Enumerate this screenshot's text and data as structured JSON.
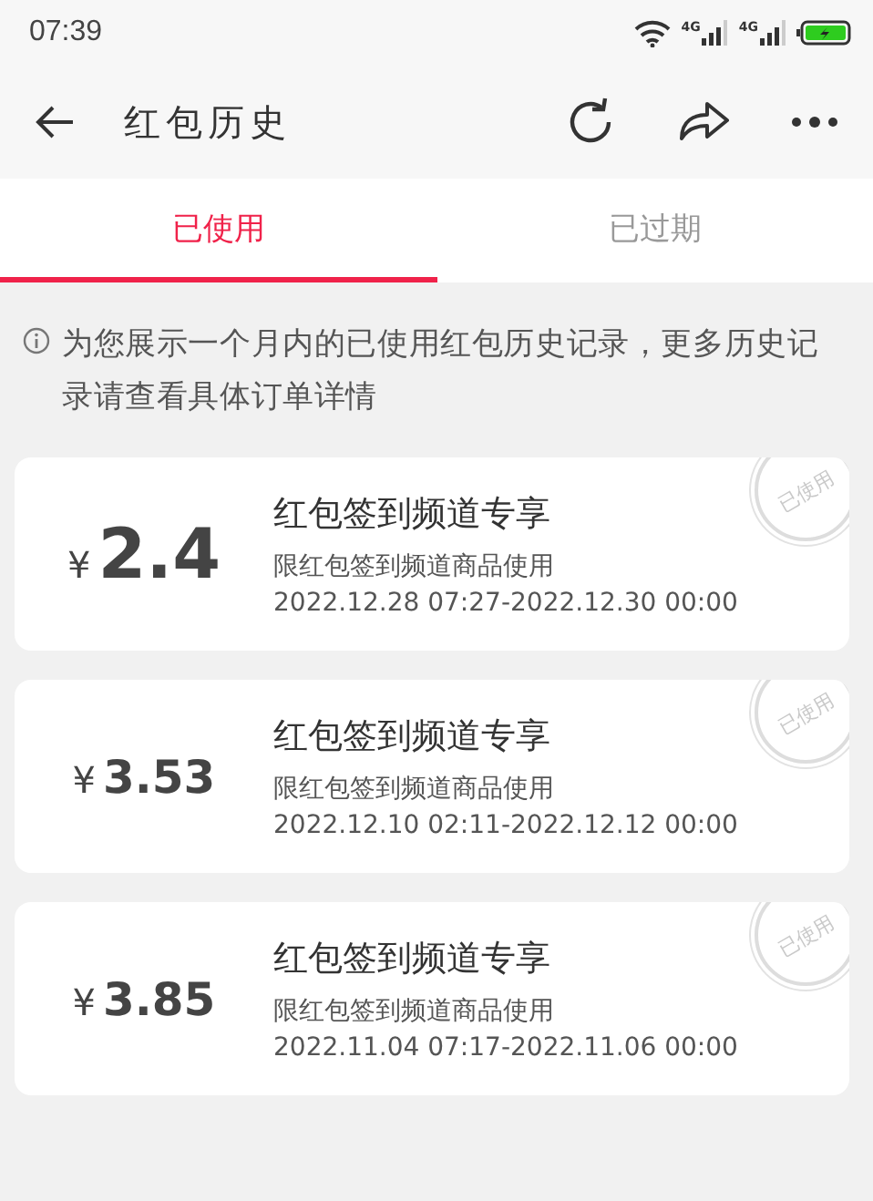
{
  "status_bar": {
    "time": "07:39",
    "network_1": "4G",
    "network_2": "4G"
  },
  "header": {
    "title": "红包历史"
  },
  "tabs": [
    {
      "label": "已使用",
      "selected": true
    },
    {
      "label": "已过期",
      "selected": false
    }
  ],
  "notice": "为您展示一个月内的已使用红包历史记录，更多历史记录请查看具体订单详情",
  "coupons": [
    {
      "currency": "¥",
      "amount": "2.4",
      "large": true,
      "title": "红包签到频道专享",
      "scope": "限红包签到频道商品使用",
      "validity": "2022.12.28 07:27-2022.12.30 00:00",
      "stamp": "已使用"
    },
    {
      "currency": "¥",
      "amount": "3.53",
      "large": false,
      "title": "红包签到频道专享",
      "scope": "限红包签到频道商品使用",
      "validity": "2022.12.10 02:11-2022.12.12 00:00",
      "stamp": "已使用"
    },
    {
      "currency": "¥",
      "amount": "3.85",
      "large": false,
      "title": "红包签到频道专享",
      "scope": "限红包签到频道商品使用",
      "validity": "2022.11.04 07:17-2022.11.06 00:00",
      "stamp": "已使用"
    }
  ]
}
